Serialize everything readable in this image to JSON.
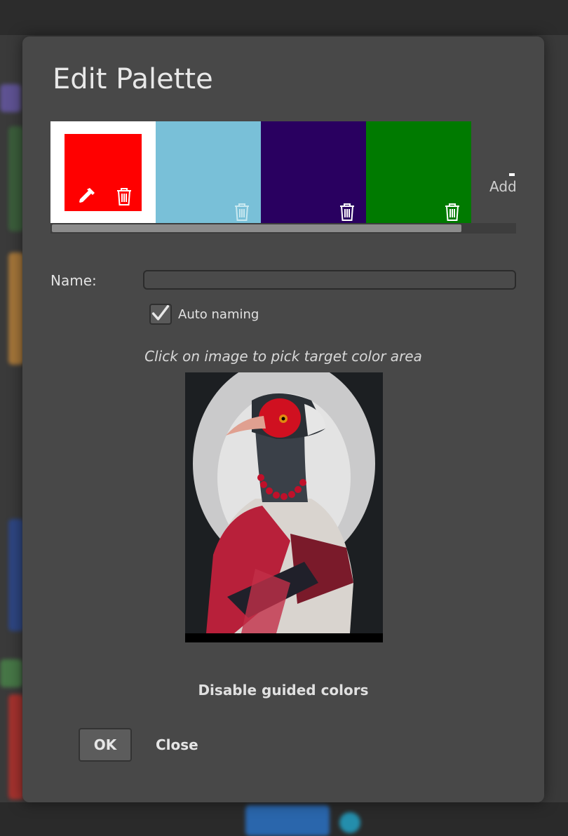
{
  "dialog": {
    "title": "Edit Palette",
    "palette": {
      "swatches": [
        {
          "color": "#ff0000",
          "selected": true
        },
        {
          "color": "#79c0d8",
          "selected": false
        },
        {
          "color": "#290060",
          "selected": false
        },
        {
          "color": "#007a00",
          "selected": false
        }
      ],
      "add_label": "Add"
    },
    "name_label": "Name:",
    "name_value": "",
    "auto_naming_label": "Auto naming",
    "auto_naming_checked": true,
    "hint": "Click on image to pick target color area",
    "disable_guided_label": "Disable guided colors",
    "ok_label": "OK",
    "close_label": "Close"
  },
  "colors": {
    "dialog_bg": "#484848",
    "text": "#e2e2e2"
  }
}
